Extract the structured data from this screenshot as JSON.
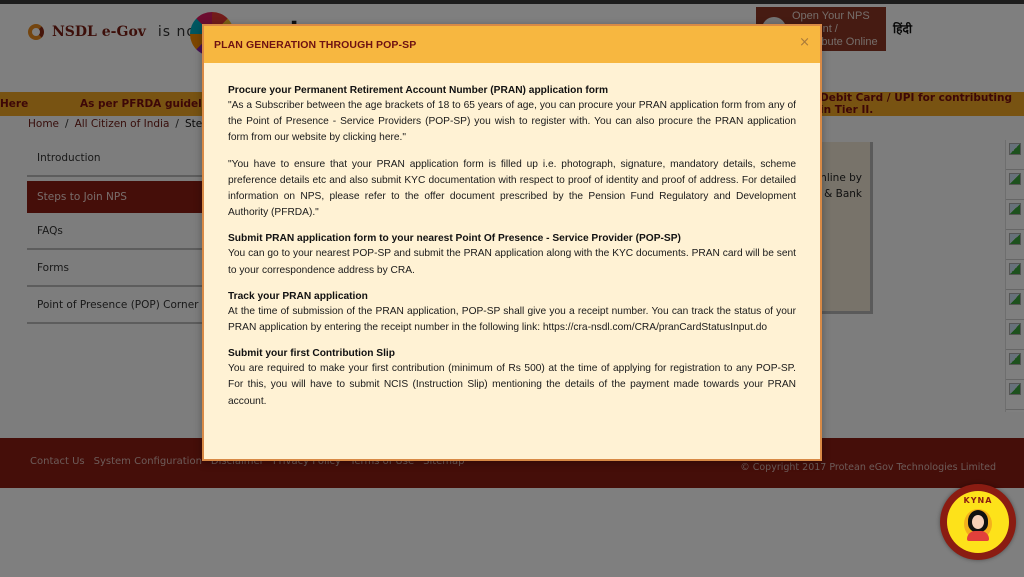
{
  "header": {
    "old_brand": "NSDL e-Gov",
    "is_now": "is now",
    "new_brand": "protean",
    "open_account_label": "Open Your NPS Account / Contribute Online",
    "language_toggle": "हिंदी"
  },
  "ticker": {
    "left": "Here",
    "middle": "As per PFRDA guidelines,",
    "right": "Debit Card / UPI for contributing in Tier II."
  },
  "breadcrumb": {
    "items": [
      "Home",
      "All Citizen of India",
      "Steps to Join NPS"
    ],
    "separator": "/"
  },
  "sidebar": {
    "items": [
      {
        "label": "Introduction",
        "active": false
      },
      {
        "label": "Steps to Join NPS",
        "active": true
      },
      {
        "label": "FAQs",
        "active": false
      },
      {
        "label": "Forms",
        "active": false
      },
      {
        "label": "Point of Presence (POP) Corner",
        "active": false
      }
    ]
  },
  "content_snippet": {
    "line1": "online by",
    "line2": "& Bank"
  },
  "footer": {
    "links": [
      "Contact Us",
      "System Configuration",
      "Disclaimer",
      "Privacy Policy",
      "Terms of Use",
      "Sitemap"
    ],
    "copyright": "© Copyright 2017 Protean eGov Technologies Limited"
  },
  "chatbot": {
    "label": "KYNA"
  },
  "modal": {
    "title": "PLAN GENERATION THROUGH POP-SP",
    "close_icon": "×",
    "sections": [
      {
        "heading": "Procure your Permanent Retirement Account Number (PRAN) application form",
        "paragraphs": [
          "\"As a Subscriber between the age brackets of 18 to 65 years of age, you can procure your PRAN application form from any of the Point of Presence - Service Providers (POP-SP) you wish to register with. You can also procure the PRAN application form from our website by clicking here.\"",
          "\"You have to ensure that your PRAN application form is filled up i.e. photograph, signature, mandatory details, scheme preference details etc and also submit KYC documentation with respect to proof of identity and proof of address. For detailed information on NPS, please refer to the offer document prescribed by the Pension Fund Regulatory and Development Authority (PFRDA).\""
        ]
      },
      {
        "heading": "Submit PRAN application form to your nearest Point Of Presence - Service Provider (POP-SP)",
        "paragraphs": [
          "You can go to your nearest POP-SP and submit the PRAN application along with the KYC documents. PRAN card will be sent to your correspondence address by CRA."
        ]
      },
      {
        "heading": "Track your PRAN application",
        "paragraphs": [
          "At the time of submission of the PRAN application, POP-SP shall give you a receipt number. You can track the status of your PRAN application by entering the receipt number in the following link: https://cra-nsdl.com/CRA/pranCardStatusInput.do"
        ]
      },
      {
        "heading": "Submit your first Contribution Slip",
        "paragraphs": [
          "You are required to make your first contribution (minimum of Rs 500) at the time of applying for registration to any POP-SP. For this, you will have to submit NCIS (Instruction Slip) mentioning the details of the payment made towards your PRAN account."
        ]
      }
    ]
  },
  "colors": {
    "brand_maroon": "#8a1c12",
    "modal_header": "#f7b740",
    "modal_body": "#fff2d4",
    "ticker": "#f1a625"
  }
}
